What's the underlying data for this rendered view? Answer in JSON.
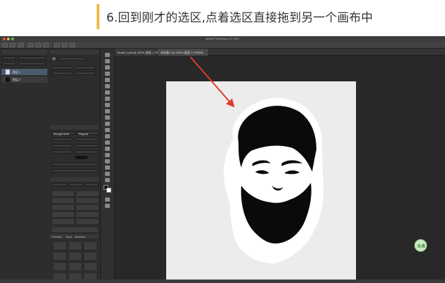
{
  "caption": {
    "text": "6.回到刚才的选区,点着选区直接拖到另一个画布中"
  },
  "window": {
    "title": "Adobe Photoshop CC 2017"
  },
  "layers_panel": {
    "layers": [
      {
        "name": "图层 1",
        "selected": true
      },
      {
        "name": "图层 0",
        "selected": false
      }
    ]
  },
  "character_panel": {
    "font_family": "Mangal Bold",
    "font_style": "Regular"
  },
  "panel_tabs": {
    "bottom": [
      "Presets",
      "Tools",
      "Brushes"
    ]
  },
  "document_tabs": [
    {
      "label": "Model 1.psd @ 100% (图层 1, RGB/8)",
      "active": false
    },
    {
      "label": "未标题-1 @ 100% (图层 0, RGB/8)",
      "active": true
    }
  ],
  "annotation": {
    "arrow_color": "#e03a2a"
  },
  "watermark": {
    "text": "头条"
  }
}
